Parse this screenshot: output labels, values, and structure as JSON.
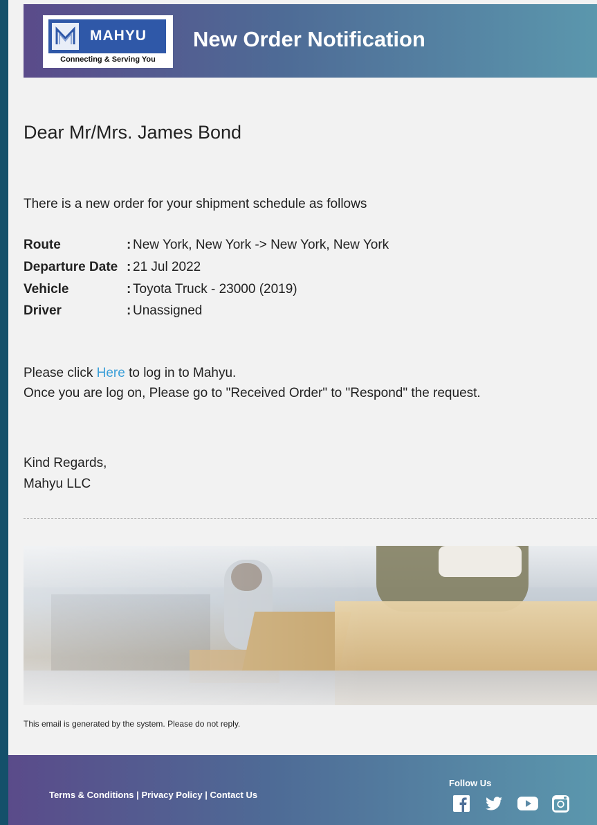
{
  "header": {
    "logo_brand": "MAHYU",
    "logo_tagline": "Connecting & Serving You",
    "title": "New Order Notification"
  },
  "greeting": "Dear Mr/Mrs. James Bond",
  "intro": "There is a new order for your shipment schedule as follows",
  "details": [
    {
      "label": "Route",
      "value": "New York, New York -> New York, New York"
    },
    {
      "label": "Departure Date",
      "value": "21 Jul 2022"
    },
    {
      "label": "Vehicle",
      "value": "Toyota Truck - 23000 (2019)"
    },
    {
      "label": "Driver",
      "value": "Unassigned"
    }
  ],
  "separator": ":",
  "instructions": {
    "prefix": "Please click ",
    "link": "Here",
    "suffix": " to log in to Mahyu.",
    "line2": "Once you are log on, Please go to \"Received Order\" to \"Respond\" the request."
  },
  "signoff": {
    "line1": "Kind Regards,",
    "line2": "Mahyu LLC"
  },
  "disclaimer": "This email is generated by the system. Please do not reply.",
  "footer": {
    "terms": "Terms & Conditions",
    "privacy": "Privacy Policy",
    "contact": "Contact Us",
    "divider": "|",
    "follow_label": "Follow Us",
    "social_icons": [
      "facebook-icon",
      "twitter-icon",
      "youtube-icon",
      "instagram-icon"
    ]
  },
  "colors": {
    "page_background": "#14506a",
    "header_gradient_start": "#5a4b8a",
    "header_gradient_end": "#5b97ad",
    "link": "#3a9ed8",
    "logo_blue": "#2f58a8"
  }
}
